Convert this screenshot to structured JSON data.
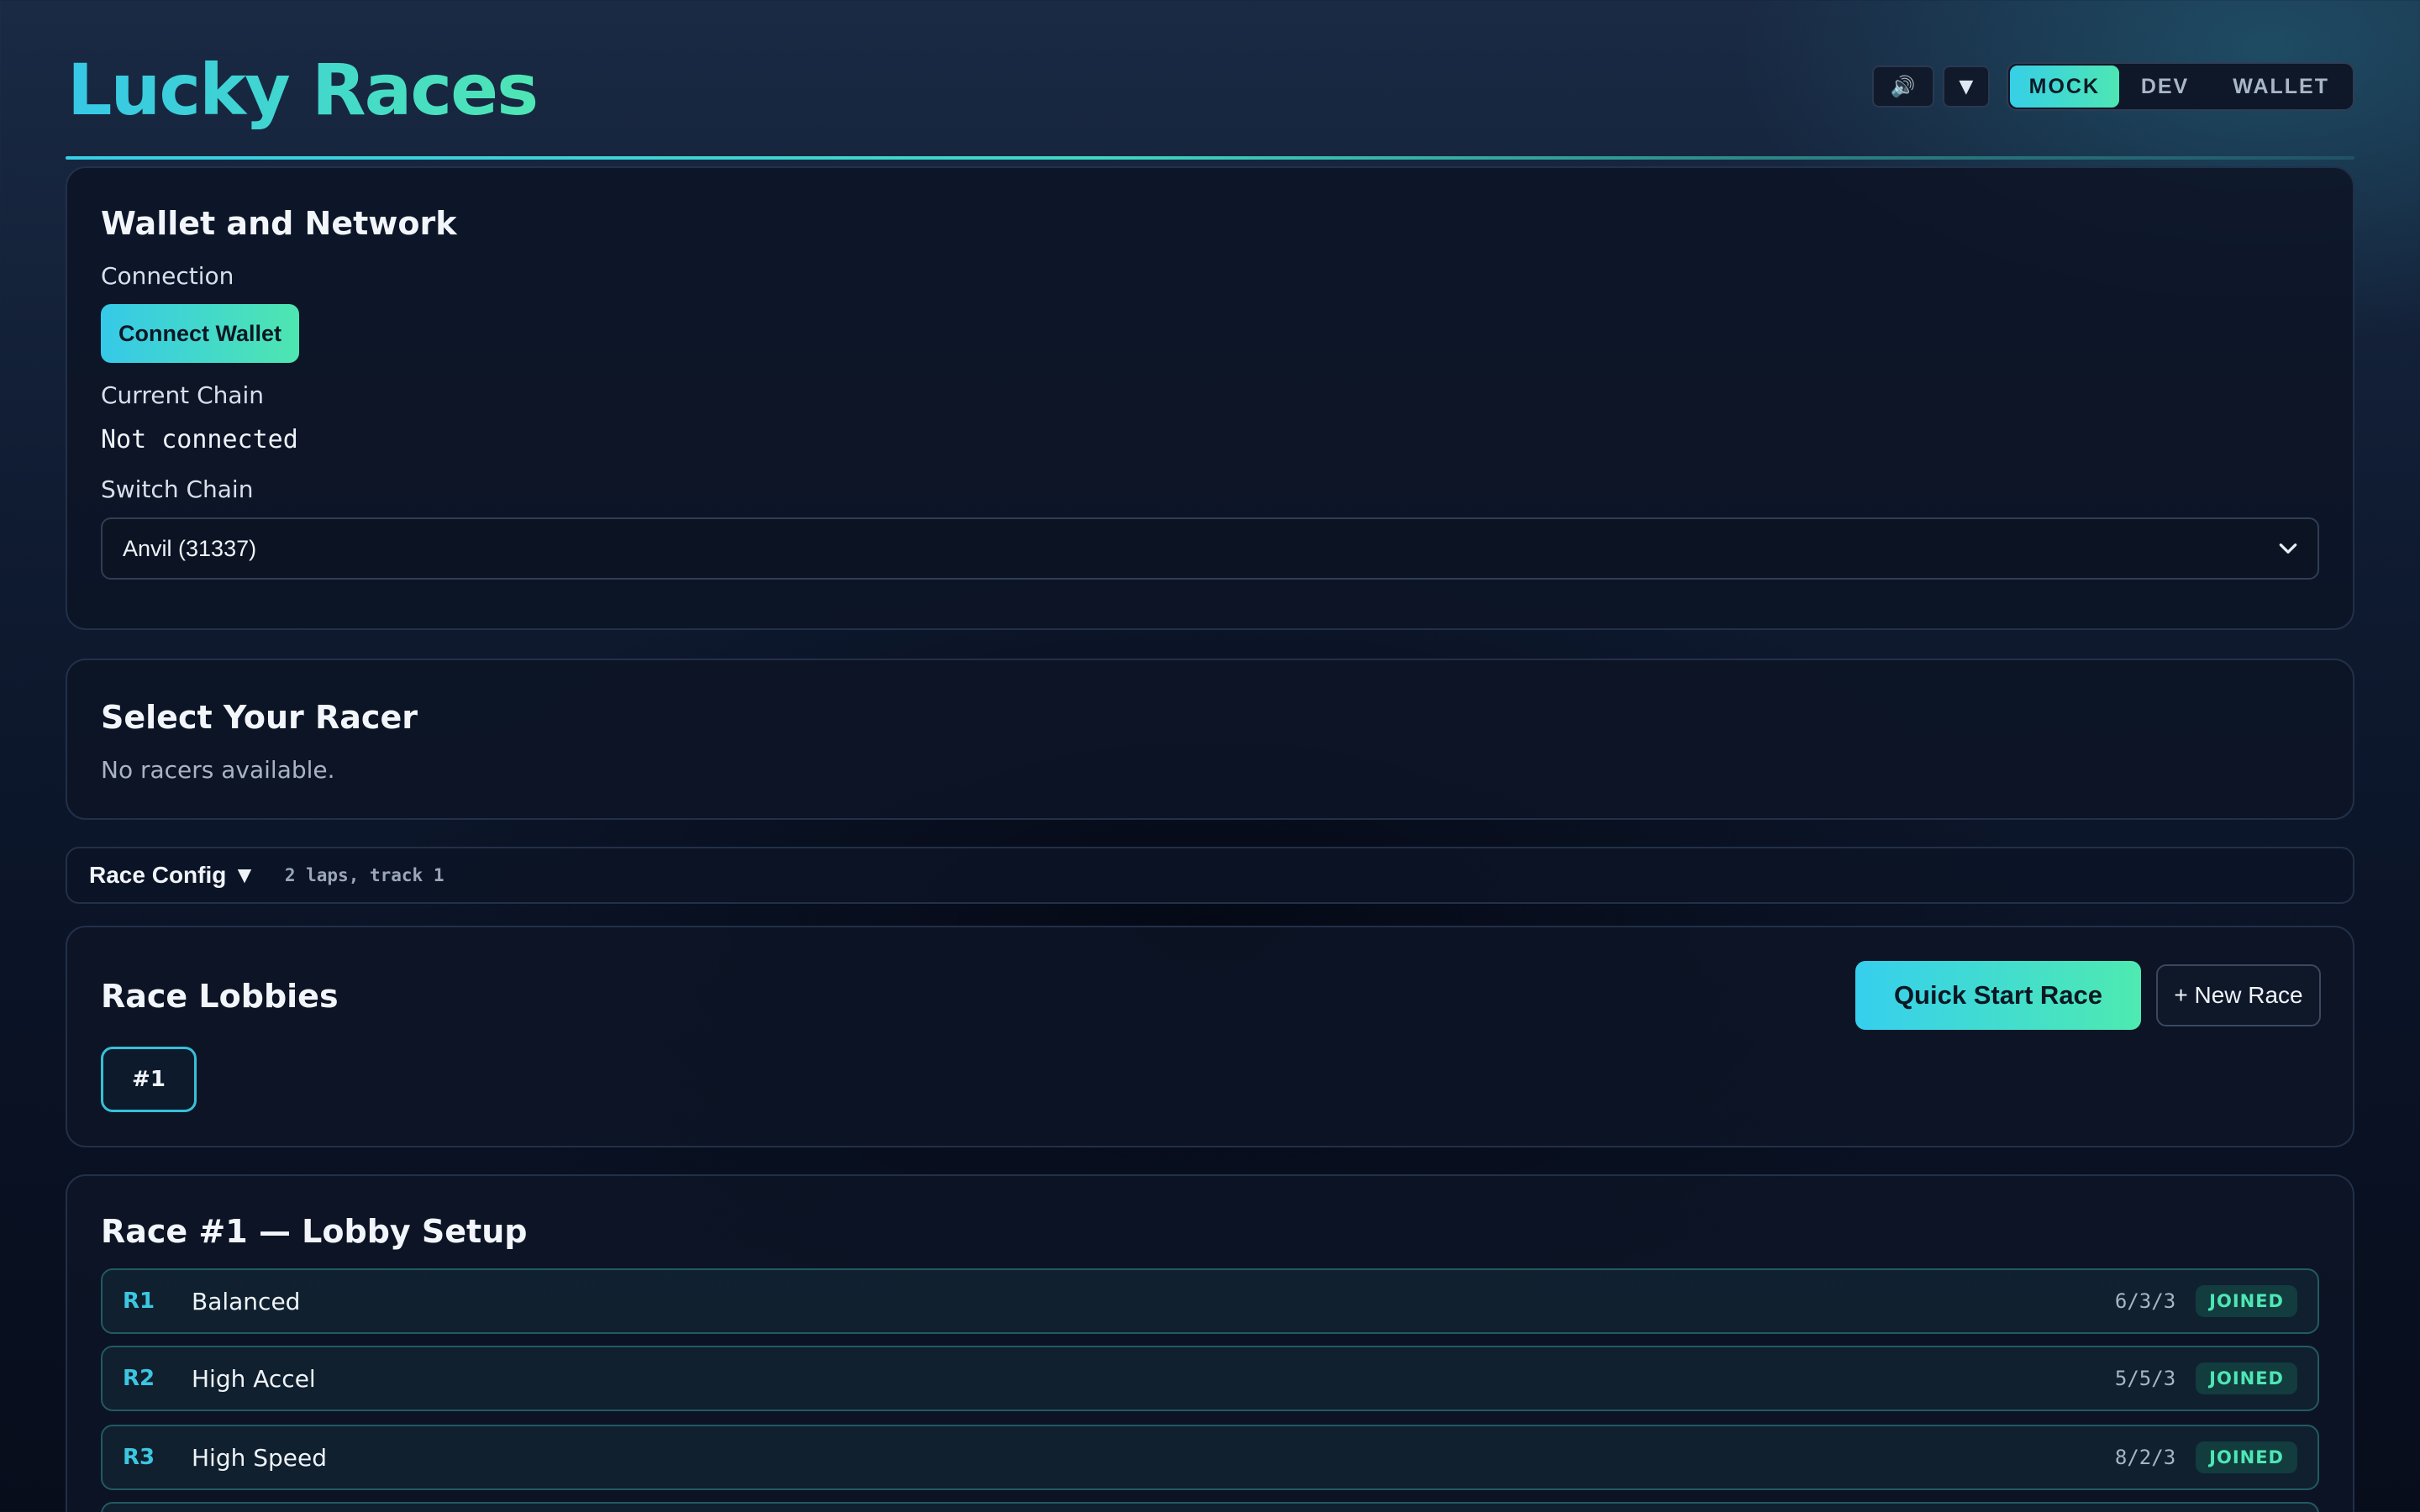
{
  "app": {
    "title": "Lucky Races"
  },
  "header": {
    "sound_icon": "speaker-icon",
    "menu_icon": "triangle-down-icon",
    "sound_glyph": "🔊",
    "menu_glyph": "▼",
    "modes": [
      "MOCK",
      "DEV",
      "WALLET"
    ],
    "active_mode": "MOCK"
  },
  "wallet": {
    "title": "Wallet and Network",
    "connection_label": "Connection",
    "connect_button": "Connect Wallet",
    "current_chain_label": "Current Chain",
    "current_chain_value": "Not connected",
    "switch_chain_label": "Switch Chain",
    "switch_chain_selected": "Anvil (31337)"
  },
  "racer_select": {
    "title": "Select Your Racer",
    "empty_text": "No racers available."
  },
  "race_config": {
    "toggle_label": "Race Config ▼",
    "summary": "2 laps, track 1"
  },
  "lobbies": {
    "title": "Race Lobbies",
    "quick_start_button": "Quick Start Race",
    "new_race_button": "+ New Race",
    "items": [
      "#1"
    ]
  },
  "lobby_setup": {
    "title": "Race #1 — Lobby Setup",
    "racers": [
      {
        "id": "R1",
        "name": "Balanced",
        "stats": "6/3/3",
        "status": "JOINED"
      },
      {
        "id": "R2",
        "name": "High Accel",
        "stats": "5/5/3",
        "status": "JOINED"
      },
      {
        "id": "R3",
        "name": "High Speed",
        "stats": "8/2/3",
        "status": "JOINED"
      }
    ]
  },
  "colors": {
    "accent_cyan": "#36c9e8",
    "accent_green": "#4ee6b4",
    "background": "#0f1b31",
    "joined_badge": "#4ee6b4"
  }
}
